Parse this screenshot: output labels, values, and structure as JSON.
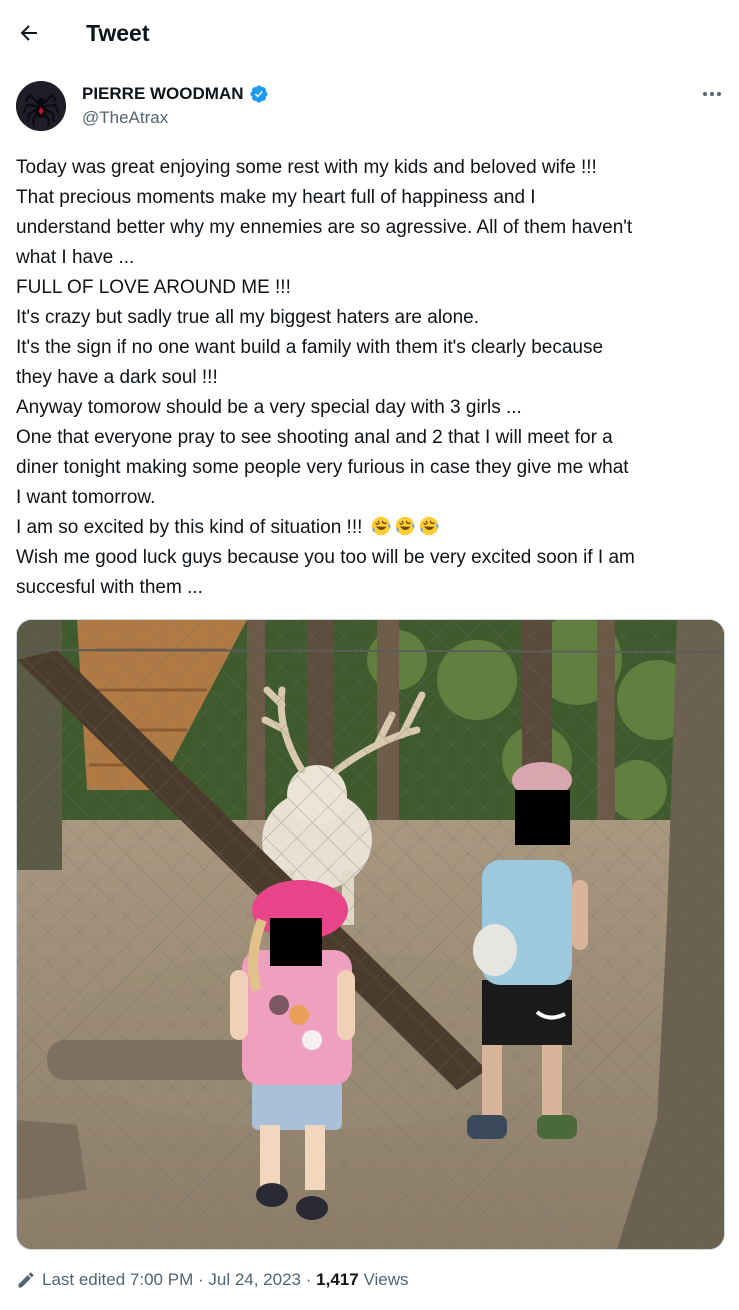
{
  "header": {
    "title": "Tweet",
    "back_icon": "arrow-left-icon"
  },
  "author": {
    "name": "PIERRE WOODMAN",
    "handle": "@TheAtrax",
    "verified": true,
    "verified_color": "#1d9bf0",
    "avatar_icon": "spider-icon"
  },
  "more_icon": "more-horizontal-icon",
  "tweet": {
    "lines": [
      "Today was great enjoying some rest with my kids and beloved wife !!!",
      "That precious moments make my heart full of happiness and I",
      "understand better why my ennemies are so agressive. All of them haven't",
      "what I have ...",
      "FULL OF LOVE AROUND ME !!!",
      "It's crazy but sadly true all my biggest haters are alone.",
      "It's the sign if no one want build a family with them it's clearly because",
      "they have a dark soul !!!",
      "Anyway tomorow should be a very special day with 3 girls ...",
      "One that everyone pray to see shooting anal and 2 that I will meet for a",
      "diner tonight making some people very furious in case they give me what",
      "I want tomorrow.",
      "I am so excited by this kind of situation !!!",
      "Wish me good luck guys because you too will be very excited soon if I am",
      "succesful with them ..."
    ],
    "emoji_count": 3,
    "emoji_name": "rolling-on-the-floor-laughing-icon"
  },
  "footer": {
    "edit_icon": "pencil-icon",
    "edited_label": "Last edited",
    "time": "7:00 PM",
    "separator": "·",
    "date": "Jul 24, 2023",
    "views_count": "1,417",
    "views_label": "Views"
  }
}
